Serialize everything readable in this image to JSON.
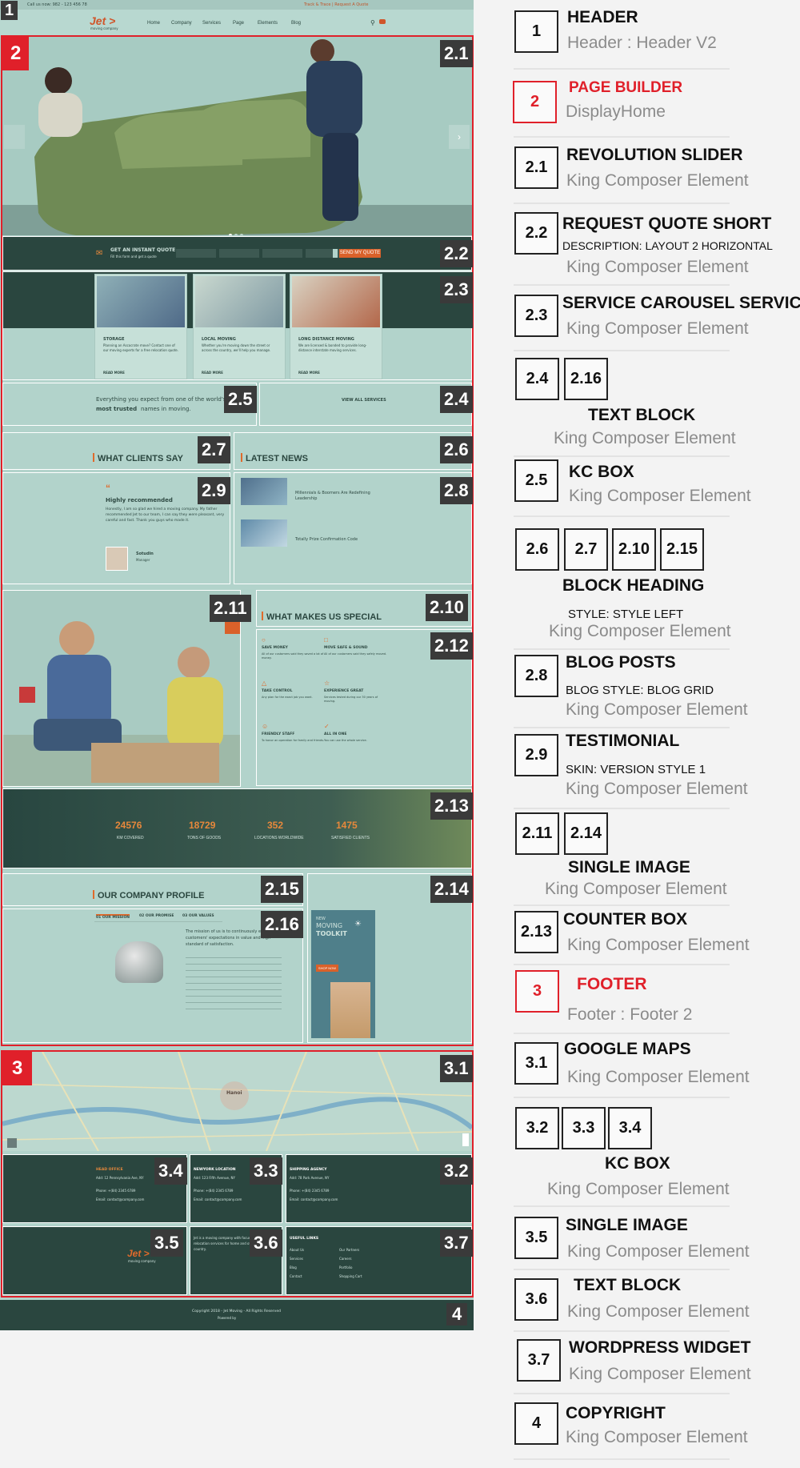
{
  "mock": {
    "header": {
      "logo": "Jet >",
      "logo_sub": "moving company",
      "topbar_phone": "Call us now: 982 - 123 456 78",
      "topbar_links": "Track & Trace | Request A Quote",
      "nav": [
        "Home",
        "Company",
        "Services",
        "Page",
        "Elements",
        "Blog"
      ]
    },
    "quote": {
      "title": "GET AN INSTANT QUOTE",
      "sub": "Fill this form and get a quote",
      "button": "SEND MY QUOTE"
    },
    "services": [
      {
        "title": "STORAGE",
        "text": "Planning an Ascocrate move? Contact one of our moving experts for a free relocation quote.",
        "more": "READ MORE"
      },
      {
        "title": "LOCAL MOVING",
        "text": "Whether you're moving down the street or across the country, we'll help you manage.",
        "more": "READ MORE"
      },
      {
        "title": "LONG DISTANCE MOVING",
        "text": "We are licensed & bonded to provide long-distance interstate moving services.",
        "more": "READ MORE"
      }
    ],
    "trusted": {
      "line1": "Everything you expect from one of the world's",
      "line2_strong": "most trusted",
      "line2_rest": "names in moving."
    },
    "view_all": "VIEW ALL SERVICES",
    "clients_heading": "WHAT CLIENTS SAY",
    "news_heading": "LATEST NEWS",
    "testimonial": {
      "title": "Highly recommended",
      "text": "Honestly, I am so glad we hired a moving company. My father recommended Jet to our team, I can say they were pleasant, very careful and fast. Thank you guys who made it.",
      "name": "Sotudin",
      "role": "Manager"
    },
    "news": [
      {
        "title": "Millennials & Boomers Are Redefining Leadership"
      },
      {
        "title": "Totally Prize Confirmation Code"
      }
    ],
    "special_heading": "WHAT MAKES US SPECIAL",
    "special_items": [
      {
        "title": "SAVE MONEY",
        "text": "All of our customers said they saved a lot of money."
      },
      {
        "title": "MOVE SAFE & SOUND",
        "text": "All of our customers said they safely moved."
      },
      {
        "title": "TAKE CONTROL",
        "text": "Any plan for the exact job you want."
      },
      {
        "title": "EXPERIENCE GREAT",
        "text": "Services tested during our 30 years of moving."
      },
      {
        "title": "FRIENDLY STAFF",
        "text": "To honor an operation for family and friends."
      },
      {
        "title": "ALL IN ONE",
        "text": "You can use the whole service."
      }
    ],
    "counters": [
      {
        "value": "24576",
        "label": "KM COVERED"
      },
      {
        "value": "18729",
        "label": "TONS OF GOODS"
      },
      {
        "value": "352",
        "label": "LOCATIONS WORLDWIDE"
      },
      {
        "value": "1475",
        "label": "SATISFIED CLIENTS"
      }
    ],
    "profile_heading": "OUR COMPANY PROFILE",
    "profile_tabs": [
      "01 OUR MISSION",
      "02 OUR PROMISE",
      "03 OUR VALUES"
    ],
    "profile_text": "The mission of us is to continuously exceed our customers' expectations in value and high standard of satisfaction.",
    "toolkit": {
      "line1": "NEW",
      "line2": "MOVING",
      "line3": "TOOLKIT",
      "button": "SHOP NOW"
    },
    "map_city": "Hanoi",
    "footer_cols": [
      {
        "title": "HEAD OFFICE",
        "lines": [
          "Add: 12 Pennsylvania Ave, NY",
          "Phone: +(84) 2345 6789",
          "Email: contact@company.com"
        ]
      },
      {
        "title": "NEWYORK LOCATION",
        "lines": [
          "Add: 123 Fifth Avenue, NY",
          "Phone: +(84) 2345 6789",
          "Email: contact@company.com"
        ]
      },
      {
        "title": "SHIPPING AGENCY",
        "lines": [
          "Add: 78 Park Avenue, NY",
          "Phone: +(84) 2345 6789",
          "Email: contact@company.com"
        ]
      }
    ],
    "footer_about": "Jet is a moving company with focus on delivering relocation services for home and office across the country.",
    "useful_links_title": "USEFUL LINKS",
    "useful_links": [
      "About Us",
      "Services",
      "Blog",
      "Contact",
      "Our Partners",
      "Careers",
      "Portfolio",
      "Shopping Cart"
    ],
    "copyright": "Copyright 2018 - Jet Moving - All Rights Reserved",
    "powered": "Powered by"
  },
  "badges": {
    "b1": "1",
    "b2": "2",
    "b2_1": "2.1",
    "b2_2": "2.2",
    "b2_3": "2.3",
    "b2_4": "2.4",
    "b2_5": "2.5",
    "b2_6": "2.6",
    "b2_7": "2.7",
    "b2_8": "2.8",
    "b2_9": "2.9",
    "b2_10": "2.10",
    "b2_11": "2.11",
    "b2_12": "2.12",
    "b2_13": "2.13",
    "b2_14": "2.14",
    "b2_15": "2.15",
    "b2_16": "2.16",
    "b3": "3",
    "b3_1": "3.1",
    "b3_2": "3.2",
    "b3_3": "3.3",
    "b3_4": "3.4",
    "b3_5": "3.5",
    "b3_6": "3.6",
    "b3_7": "3.7",
    "b4": "4"
  },
  "legend": {
    "header": {
      "num": "1",
      "title": "HEADER",
      "sub": "Header : Header V2"
    },
    "page_builder": {
      "num": "2",
      "title": "PAGE BUILDER",
      "sub": "DisplayHome"
    },
    "rev_slider": {
      "num": "2.1",
      "title": "REVOLUTION SLIDER",
      "sub": "King Composer Element"
    },
    "request_quote": {
      "num": "2.2",
      "title": "REQUEST QUOTE SHORT",
      "note": "DESCRIPTION: LAYOUT 2 HORIZONTAL",
      "sub": "King Composer Element"
    },
    "service_carousel": {
      "num": "2.3",
      "title": "SERVICE CAROUSEL SERVICE",
      "sub": "King Composer Element"
    },
    "text_block": {
      "nums": [
        "2.4",
        "2.16"
      ],
      "title": "TEXT BLOCK",
      "sub": "King Composer Element"
    },
    "kc_box": {
      "num": "2.5",
      "title": "KC BOX",
      "sub": "King Composer Element"
    },
    "block_heading": {
      "nums": [
        "2.6",
        "2.7",
        "2.10",
        "2.15"
      ],
      "title": "BLOCK HEADING",
      "note": "STYLE: STYLE  LEFT",
      "sub": "King Composer Element"
    },
    "blog_posts": {
      "num": "2.8",
      "title": "BLOG POSTS",
      "note": "BLOG STYLE: BLOG GRID",
      "sub": "King Composer Element"
    },
    "testimonial": {
      "num": "2.9",
      "title": "TESTIMONIAL",
      "note": "SKIN: VERSION STYLE 1",
      "sub": "King Composer Element"
    },
    "single_image": {
      "nums": [
        "2.11",
        "2.14"
      ],
      "title": "SINGLE IMAGE",
      "sub": "King Composer Element"
    },
    "counter_box": {
      "num": "2.13",
      "title": "COUNTER BOX",
      "sub": "King Composer Element"
    },
    "footer": {
      "num": "3",
      "title": "FOOTER",
      "sub": "Footer : Footer 2"
    },
    "google_maps": {
      "num": "3.1",
      "title": "GOOGLE MAPS",
      "sub": "King Composer Element"
    },
    "footer_kc_box": {
      "nums": [
        "3.2",
        "3.3",
        "3.4"
      ],
      "title": "KC BOX",
      "sub": "King Composer Element"
    },
    "footer_image": {
      "num": "3.5",
      "title": "SINGLE IMAGE",
      "sub": "King Composer Element"
    },
    "footer_text": {
      "num": "3.6",
      "title": "TEXT BLOCK",
      "sub": "King Composer Element"
    },
    "wp_widget": {
      "num": "3.7",
      "title": "WORDPRESS WIDGET",
      "sub": "King Composer Element"
    },
    "copyright": {
      "num": "4",
      "title": "COPYRIGHT",
      "sub": "King Composer Element"
    }
  }
}
